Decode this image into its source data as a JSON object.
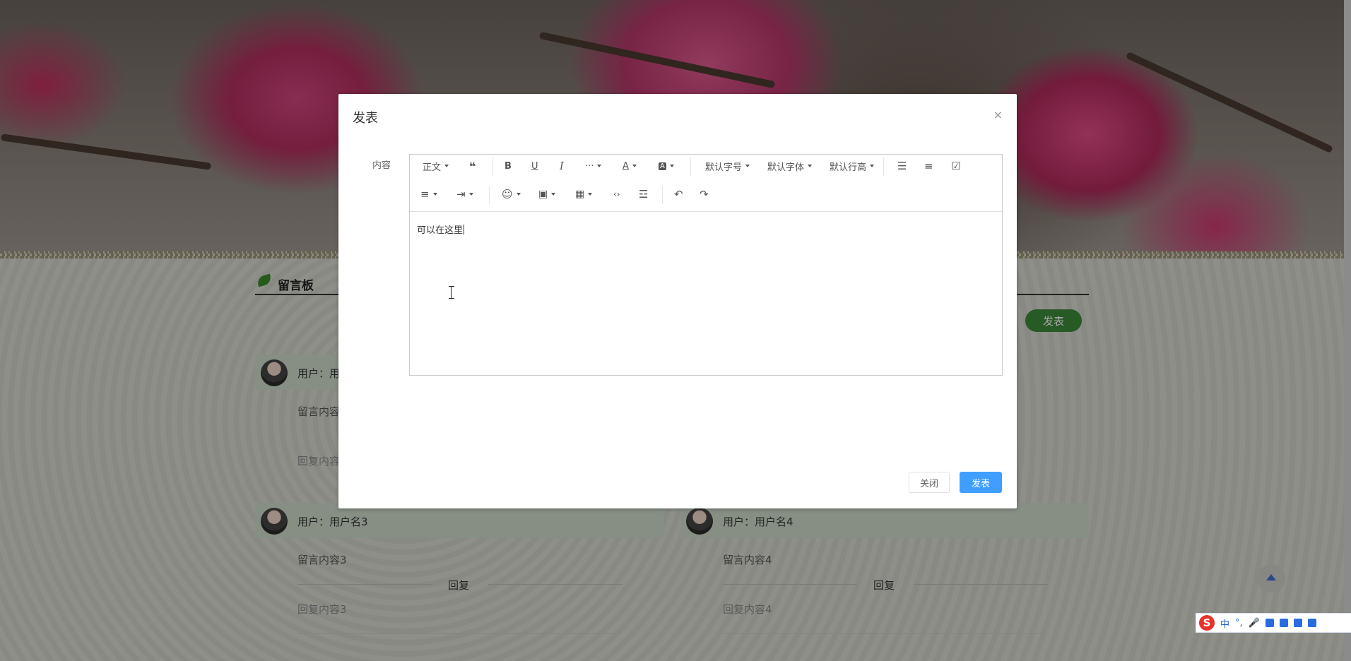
{
  "dialog": {
    "title": "发表",
    "close_icon": "×",
    "field_label": "内容",
    "editor_text": "可以在这里",
    "close_button": "关闭",
    "submit_button": "发表"
  },
  "toolbar": {
    "paragraph": "正文",
    "font_size": "默认字号",
    "font_family": "默认字体",
    "line_height": "默认行高"
  },
  "board": {
    "title": "留言板",
    "publish_button": "发表",
    "cards": [
      {
        "user": "用户：用",
        "msg": "留言内容",
        "reply": "回复内容"
      },
      {
        "user": "用户：用户名3",
        "msg": "留言内容3",
        "reply_label": "回复",
        "reply": "回复内容3"
      },
      {
        "user": "用户：用户名4",
        "msg": "留言内容4",
        "reply_label": "回复",
        "reply": "回复内容4"
      }
    ]
  },
  "ime": {
    "mode": "中",
    "punct": "°,"
  },
  "colors": {
    "accent": "#409eff",
    "board_green": "#3d8a3a",
    "card_head": "#cfdccc"
  }
}
